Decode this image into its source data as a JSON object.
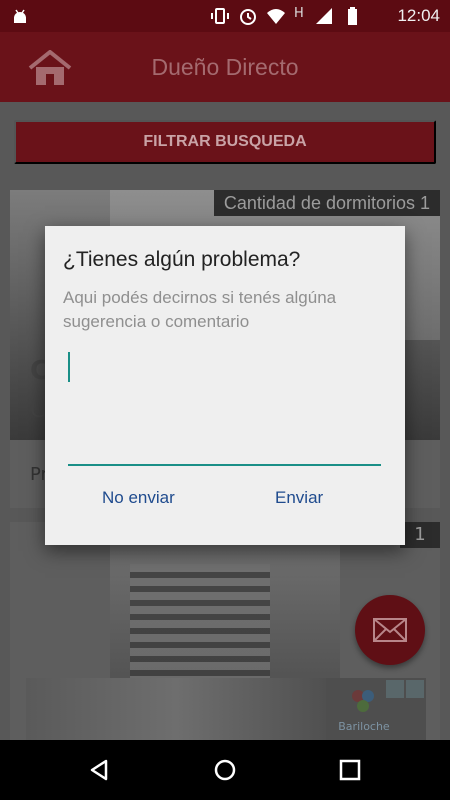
{
  "status_bar": {
    "time": "12:04",
    "network_letter": "H",
    "icons": [
      "android-debug-icon",
      "vibrate-icon",
      "alarm-icon",
      "wifi-icon",
      "signal-icon",
      "battery-icon"
    ]
  },
  "app_bar": {
    "title": "Dueño Directo",
    "home_icon": "home-icon"
  },
  "filter_button": {
    "label": "FILTRAR BUSQUEDA"
  },
  "listings": [
    {
      "badge": "Cantidad de dormitorios 1",
      "partial_title": "C",
      "partial_subtitle": "C",
      "partial_footer": "Pr"
    },
    {
      "badge": "1"
    }
  ],
  "fab": {
    "icon": "mail-icon"
  },
  "ad": {
    "brand_text": "Bariloche"
  },
  "dialog": {
    "title": "¿Tienes algún problema?",
    "message": "Aqui podés decirnos si tenés algúna sugerencia o comentario",
    "input_value": "",
    "cancel_label": "No enviar",
    "confirm_label": "Enviar"
  },
  "nav_bar": {
    "buttons": [
      "back-icon",
      "home-circle-icon",
      "recents-icon"
    ]
  },
  "colors": {
    "primary": "#6a1219",
    "accent": "#1a8f87",
    "dialog_button": "#1f4b8e"
  }
}
